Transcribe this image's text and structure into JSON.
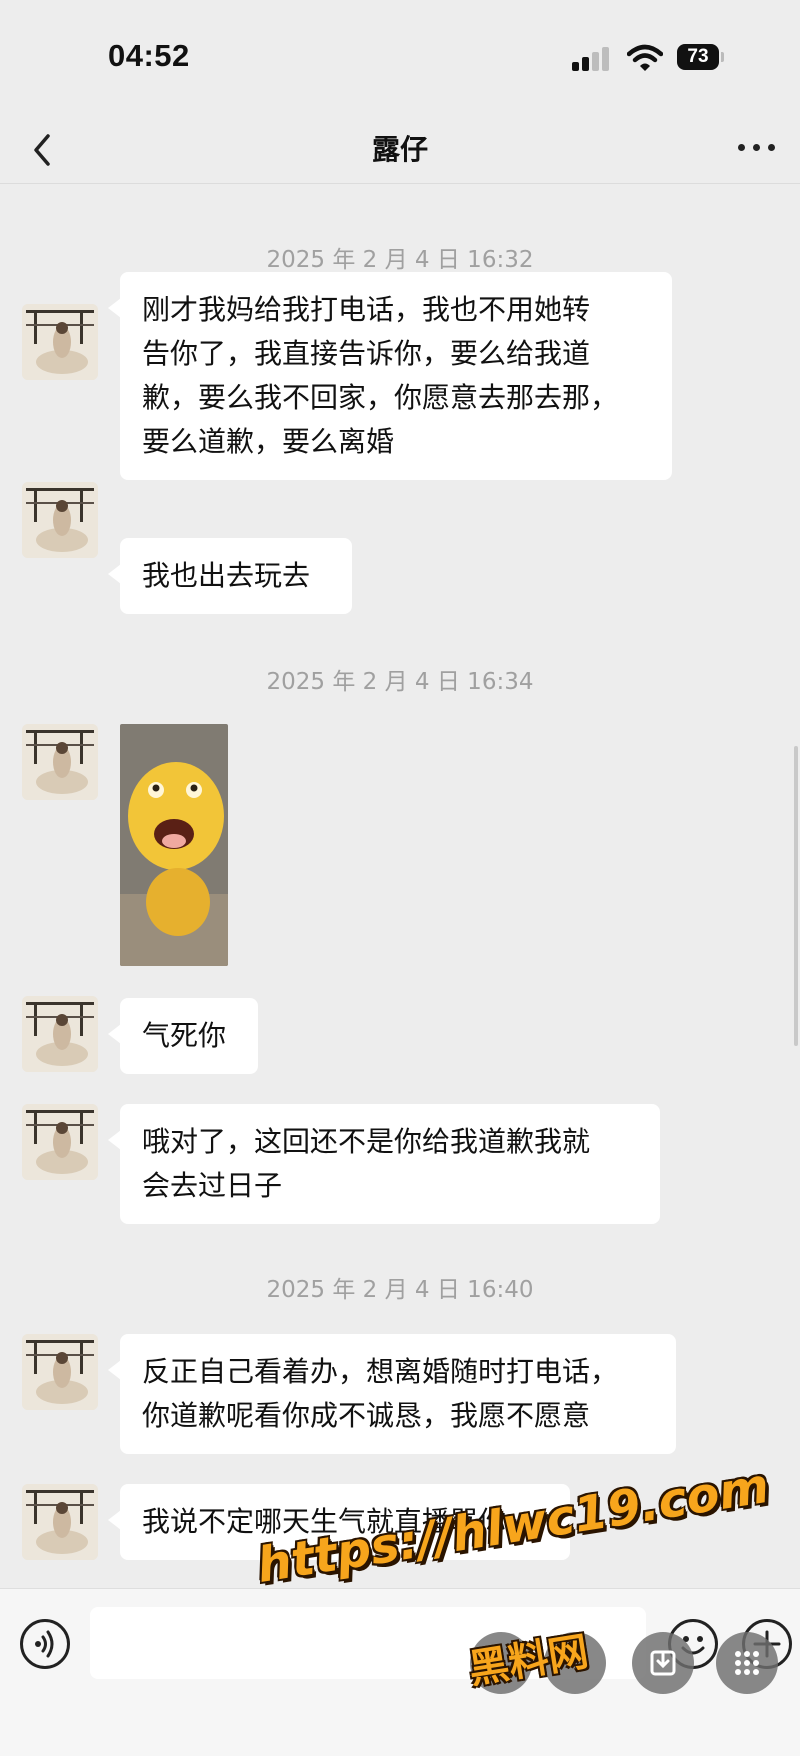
{
  "status_bar": {
    "time": "04:52",
    "battery": "73"
  },
  "nav": {
    "title": "露仔"
  },
  "messages": [
    {
      "timestamp": "2025 年 2 月 4 日  16:32"
    },
    {
      "text": "刚才我妈给我打电话，我也不用她转\n告你了，我直接告诉你，要么给我道\n歉，要么我不回家，你愿意去那去那，\n要么道歉，要么离婚"
    },
    {
      "text": "我也出去玩去"
    },
    {
      "timestamp": "2025 年 2 月 4 日  16:34"
    },
    {
      "sticker": "yellow-cartoon-sticker"
    },
    {
      "text": "气死你"
    },
    {
      "text": "哦对了，这回还不是你给我道歉我就\n会去过日子"
    },
    {
      "timestamp": "2025 年 2 月 4 日  16:40"
    },
    {
      "text": "反正自己看着办，想离婚随时打电话，\n你道歉呢看你成不诚恳，我愿不愿意"
    },
    {
      "text": "我说不定哪天生气就直播骂你"
    }
  ],
  "watermark": {
    "url": "https://hlwc19.com",
    "name": "黑料网"
  },
  "icons": {
    "back": "chevron-left-icon",
    "more": "more-dots-icon",
    "voice": "voice-icon",
    "emoji": "emoji-icon",
    "plus": "plus-icon"
  }
}
